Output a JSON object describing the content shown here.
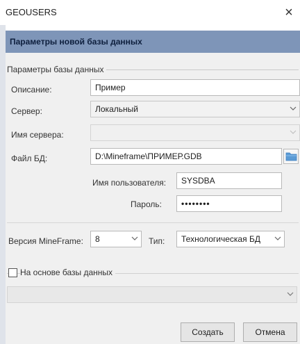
{
  "window": {
    "title": "GEOUSERS",
    "close_glyph": "×"
  },
  "header": {
    "title": "Параметры новой базы данных"
  },
  "db_params": {
    "legend": "Параметры базы данных",
    "description_label": "Описание:",
    "description_value": "Пример",
    "server_label": "Сервер:",
    "server_value": "Локальный",
    "server_name_label": "Имя сервера:",
    "server_name_value": "",
    "db_file_label": "Файл БД:",
    "db_file_value": "D:\\Mineframe\\ПРИМЕР.GDB",
    "username_label": "Имя пользователя:",
    "username_value": "SYSDBA",
    "password_label": "Пароль:",
    "password_value": "••••••••"
  },
  "version": {
    "mineframe_label": "Версия MineFrame:",
    "mineframe_value": "8",
    "type_label": "Тип:",
    "type_value": "Технологическая БД"
  },
  "based_on": {
    "checkbox_label": "На основе базы данных",
    "checked": false,
    "select_value": ""
  },
  "buttons": {
    "create": "Создать",
    "cancel": "Отмена"
  },
  "icons": {
    "dropdown": "chevron-down-icon",
    "folder": "folder-icon",
    "close": "close-icon"
  },
  "colors": {
    "header_band": "#7e95b8",
    "dialog_body": "#f0f0f0",
    "folder_icon": "#5b9bd5"
  }
}
